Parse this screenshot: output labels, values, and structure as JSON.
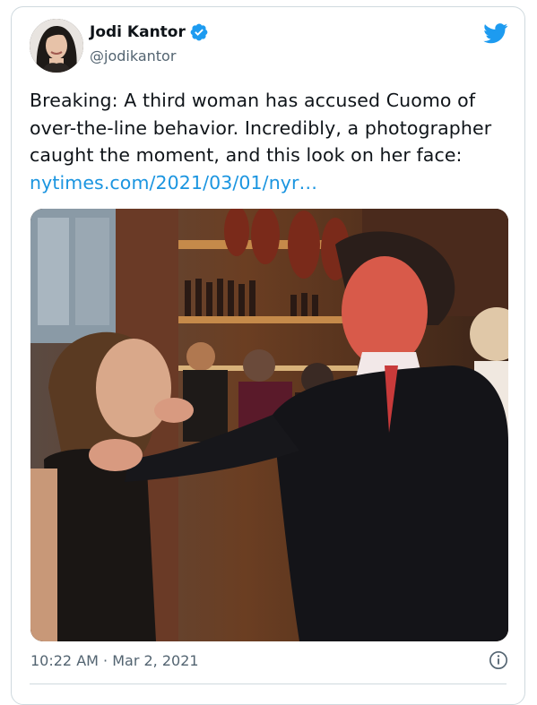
{
  "tweet": {
    "author": {
      "display_name": "Jodi Kantor",
      "handle": "@jodikantor",
      "verified_icon": "verified-badge-icon",
      "avatar": "avatar-photo"
    },
    "text_before_link": "Breaking: A third woman has accused Cuomo of over-the-line behavior. Incredibly, a photographer caught the moment, and this look on her face: ",
    "link_text": "nytimes.com/2021/03/01/nyr…",
    "timestamp": "10:22 AM · Mar 2, 2021",
    "media": "photo"
  },
  "icons": {
    "brand": "twitter-bird-icon",
    "info": "info-icon"
  },
  "colors": {
    "brand": "#1d9bf0",
    "link": "#1b95e0",
    "secondary_text": "#536471",
    "border": "#cfd9de"
  }
}
